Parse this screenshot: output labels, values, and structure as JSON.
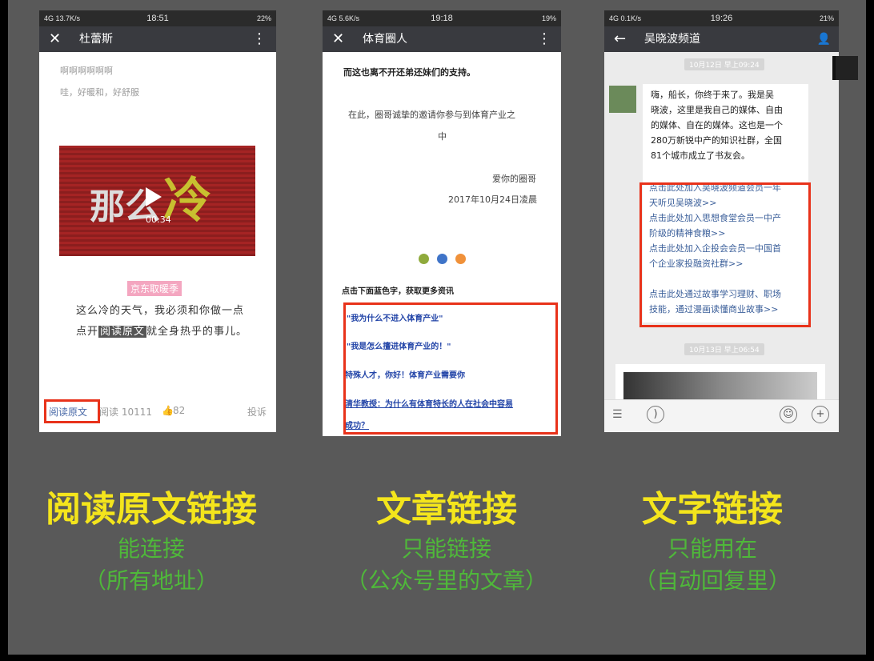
{
  "panels": [
    {
      "status": {
        "left": "4G 13.7K/s",
        "time": "18:51",
        "right": "22%"
      },
      "nav": {
        "close": "✕",
        "title": "杜蕾斯",
        "more": "⋮"
      },
      "lines": [
        "啊啊啊啊啊啊",
        "哇，好暖和，好舒服"
      ],
      "video": {
        "text1": "那么",
        "text2": "冷",
        "duration": "00:34"
      },
      "badge": "京东取暖季",
      "body1": "这么冷的天气，我必须和你做一点",
      "body2_pre": "点开",
      "body2_hl": "阅读原文",
      "body2_post": "就全身热乎的事儿。",
      "footer": {
        "read_original": "阅读原文",
        "reads": "阅读 10111",
        "likes": "82",
        "complain": "投诉"
      }
    },
    {
      "status": {
        "left": "4G 5.6K/s",
        "time": "19:18",
        "right": "19%"
      },
      "nav": {
        "close": "✕",
        "title": "体育圈人",
        "more": "⋮"
      },
      "top": "而这也离不开还弟还妹们的支持。",
      "invite1": "在此，圈哥诚挚的邀请你参与到体育产业之",
      "invite2": "中",
      "sign1": "爱你的圈哥",
      "sign2": "2017年10月24日凌晨",
      "dots": [
        "#8faa3c",
        "#3f74c8",
        "#f0913a"
      ],
      "prompt": "点击下面蓝色字，获取更多资讯",
      "links": [
        "\"我为什么不进入体育产业\"",
        "\"我是怎么擅进体育产业的！\"",
        "特殊人才，你好！体育产业需要你",
        "清华教授：为什么有体育特长的人在社会中容易",
        "成功？"
      ]
    },
    {
      "status": {
        "left": "4G 0.1K/s",
        "time": "19:26",
        "right": "21%"
      },
      "nav": {
        "back": "←",
        "title": "吴晓波频道",
        "person": "👤"
      },
      "stamp1": "10月12日 早上09:24",
      "stamp2": "10月13日 早上06:54",
      "msg": [
        "嗨，船长，你终于来了。我是吴",
        "晓波，这里是我自己的媒体、自由",
        "的媒体、自在的媒体。这也是一个",
        "280万新锐中产的知识社群，全国",
        "81个城市成立了书友会。"
      ],
      "links": [
        "点击此处加入吴晓波频道会员一年",
        "天听见吴晓波>>",
        "点击此处加入思想食堂会员一中产",
        "阶级的精神食粮>>",
        "点击此处加入企投会会员一中国首",
        "个企业家投融资社群>>",
        "",
        "点击此处通过故事学习理财、职场",
        "技能，通过漫画读懂商业故事>>"
      ]
    }
  ],
  "captions": [
    {
      "title": "阅读原文链接",
      "sub1": "能连接",
      "sub2": "（所有地址）"
    },
    {
      "title": "文章链接",
      "sub1": "只能链接",
      "sub2": "（公众号里的文章）"
    },
    {
      "title": "文字链接",
      "sub1": "只能用在",
      "sub2": "（自动回复里）"
    }
  ],
  "colors": {
    "highlight": "#e8321a",
    "caption_title": "#f4e51c",
    "caption_sub": "#4fb83a"
  }
}
